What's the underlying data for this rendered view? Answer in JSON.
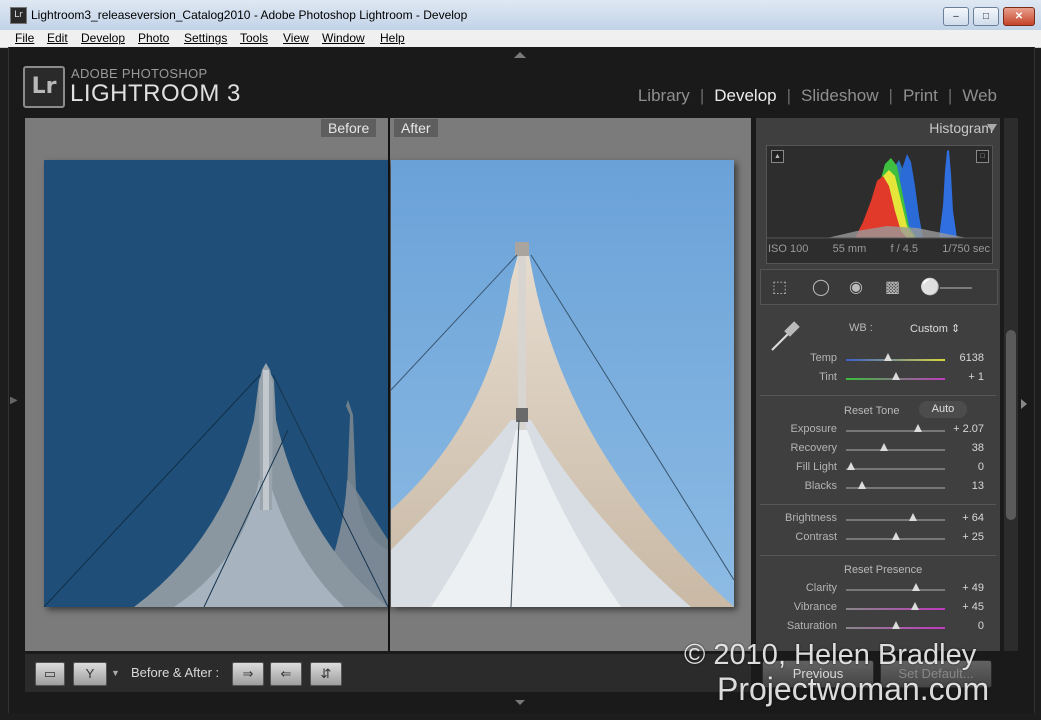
{
  "window": {
    "app_icon": "Lr",
    "title": "Lightroom3_releaseversion_Catalog2010 - Adobe Photoshop Lightroom - Develop",
    "min_icon": "minimize-icon",
    "max_icon": "maximize-icon",
    "close_icon": "close-icon"
  },
  "menu": [
    "File",
    "Edit",
    "Develop",
    "Photo",
    "Settings",
    "Tools",
    "View",
    "Window",
    "Help"
  ],
  "logo": {
    "badge": "Lr",
    "small": "ADOBE PHOTOSHOP",
    "big": "LIGHTROOM 3"
  },
  "modules": [
    "Library",
    "Develop",
    "Slideshow",
    "Print",
    "Web"
  ],
  "active_module": "Develop",
  "view": {
    "before_label": "Before",
    "after_label": "After"
  },
  "histogram": {
    "title": "Histogram",
    "iso": "ISO 100",
    "focal": "55 mm",
    "aperture": "f / 4.5",
    "shutter": "1/750 sec"
  },
  "basic": {
    "wb_label": "WB :",
    "wb_value": "Custom",
    "reset_tone": "Reset Tone",
    "auto": "Auto",
    "reset_presence": "Reset Presence",
    "sliders": [
      {
        "label": "Temp",
        "value": "6138",
        "pos": 0.42
      },
      {
        "label": "Tint",
        "value": "+ 1",
        "pos": 0.51
      },
      {
        "label": "Exposure",
        "value": "+ 2.07",
        "pos": 0.73
      },
      {
        "label": "Recovery",
        "value": "38",
        "pos": 0.38
      },
      {
        "label": "Fill Light",
        "value": "0",
        "pos": 0.05
      },
      {
        "label": "Blacks",
        "value": "13",
        "pos": 0.16
      },
      {
        "label": "Brightness",
        "value": "+ 64",
        "pos": 0.68
      },
      {
        "label": "Contrast",
        "value": "+ 25",
        "pos": 0.5
      },
      {
        "label": "Clarity",
        "value": "+ 49",
        "pos": 0.71
      },
      {
        "label": "Vibrance",
        "value": "+ 45",
        "pos": 0.7
      },
      {
        "label": "Saturation",
        "value": "0",
        "pos": 0.5
      }
    ]
  },
  "toolbar": {
    "before_after_label": "Before & After :",
    "previous": "Previous",
    "set_default": "Set Default..."
  },
  "watermark": {
    "line1": "© 2010, Helen Bradley",
    "line2": "Projectwoman.com"
  },
  "colors": {
    "panel": "#3f3f3f",
    "sky_before": "#1f4f78",
    "sky_after": "#6da4d8"
  }
}
